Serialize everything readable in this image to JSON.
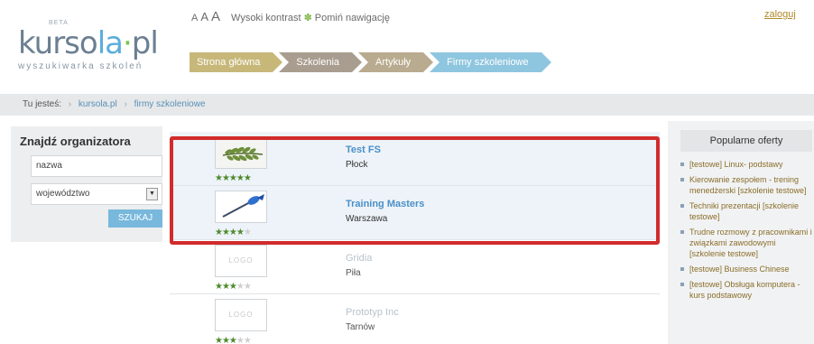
{
  "header": {
    "logo": {
      "beta": "BETA",
      "word_a": "kurso",
      "word_b": "la",
      "word_c": "·",
      "word_d": "pl",
      "tagline": "wyszukiwarka szkoleń"
    },
    "font_sizes": [
      "A",
      "A",
      "A"
    ],
    "high_contrast": "Wysoki kontrast",
    "skip_nav": "Pomiń nawigację",
    "login": "zaloguj",
    "nav": [
      "Strona główna",
      "Szkolenia",
      "Artykuły",
      "Firmy szkoleniowe"
    ]
  },
  "breadcrumb": {
    "prefix": "Tu jesteś:",
    "items": [
      "kursola.pl",
      "firmy szkoleniowe"
    ]
  },
  "finder": {
    "title": "Znajdź organizatora",
    "name_value": "nazwa",
    "province_value": "województwo",
    "search_label": "SZUKAJ"
  },
  "companies": [
    {
      "name": "Test FS",
      "city": "Płock",
      "rating": 5
    },
    {
      "name": "Training Masters",
      "city": "Warszawa",
      "rating": 4
    },
    {
      "name": "Gridia",
      "city": "Piła",
      "rating": 3,
      "logo_text": "LOGO"
    },
    {
      "name": "Prototyp Inc",
      "city": "Tarnów",
      "rating": 3,
      "logo_text": "LOGO"
    }
  ],
  "popular": {
    "title": "Popularne oferty",
    "items": [
      "[testowe] Linux- podstawy",
      "Kierowanie zespołem - trening menedżerski [szkolenie testowe]",
      "Techniki prezentacji [szkolenie testowe]",
      "Trudne rozmowy z pracownikami i związkami zawodowymi [szkolenie testowe]",
      "[testowe] Business Chinese",
      "[testowe] Obsługa komputera - kurs podstawowy"
    ]
  },
  "colors": {
    "accent_blue": "#4a90c8",
    "highlight_frame": "#d22b2b",
    "star_green": "#4e8a2e"
  }
}
